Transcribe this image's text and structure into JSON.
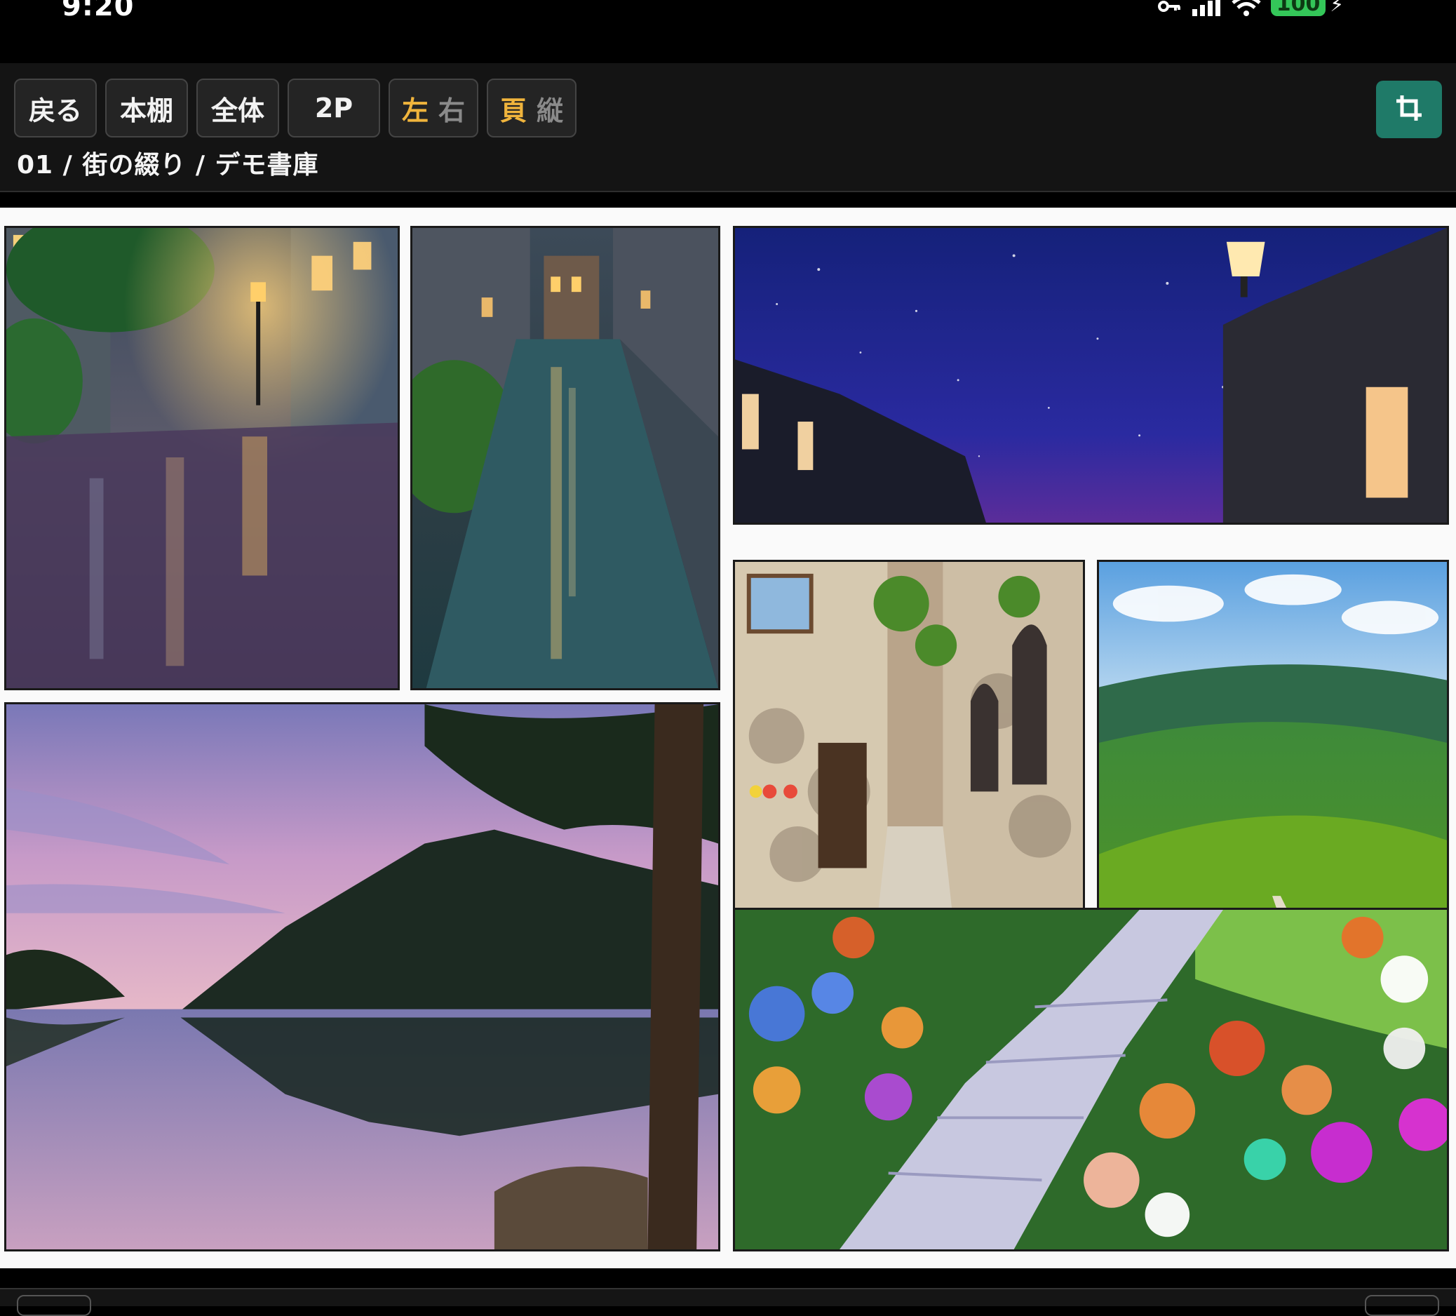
{
  "status_bar": {
    "time": "9:20",
    "battery": "100",
    "icons": [
      "key-icon",
      "cellular-signal-icon",
      "wifi-icon",
      "battery-icon",
      "charging-bolt-icon"
    ]
  },
  "toolbar": {
    "back_label": "戻る",
    "bookshelf_label": "本棚",
    "full_label": "全体",
    "two_page_label": "2P",
    "direction": {
      "active": "左",
      "inactive": "右"
    },
    "orientation": {
      "active": "頁",
      "inactive": "縦"
    },
    "crop_icon": "crop-icon",
    "accent_color": "#f0b43c",
    "crop_button_color": "#1f7a68"
  },
  "breadcrumb": "01 / 街の綴り / デモ書庫",
  "panels": [
    {
      "name": "rainy-lamp-street",
      "scene": "rainy cobblestone street with lamp post"
    },
    {
      "name": "wet-alley",
      "scene": "wet narrow alley at night"
    },
    {
      "name": "starry-night-sky",
      "scene": "starry sky with street lamp"
    },
    {
      "name": "flower-stone-alley",
      "scene": "stone alley with flower pots"
    },
    {
      "name": "green-hills",
      "scene": "rolling green hills with path"
    },
    {
      "name": "lake-sunset",
      "scene": "lake at dusk with forest"
    },
    {
      "name": "flower-path",
      "scene": "stone steps through flower garden"
    }
  ]
}
